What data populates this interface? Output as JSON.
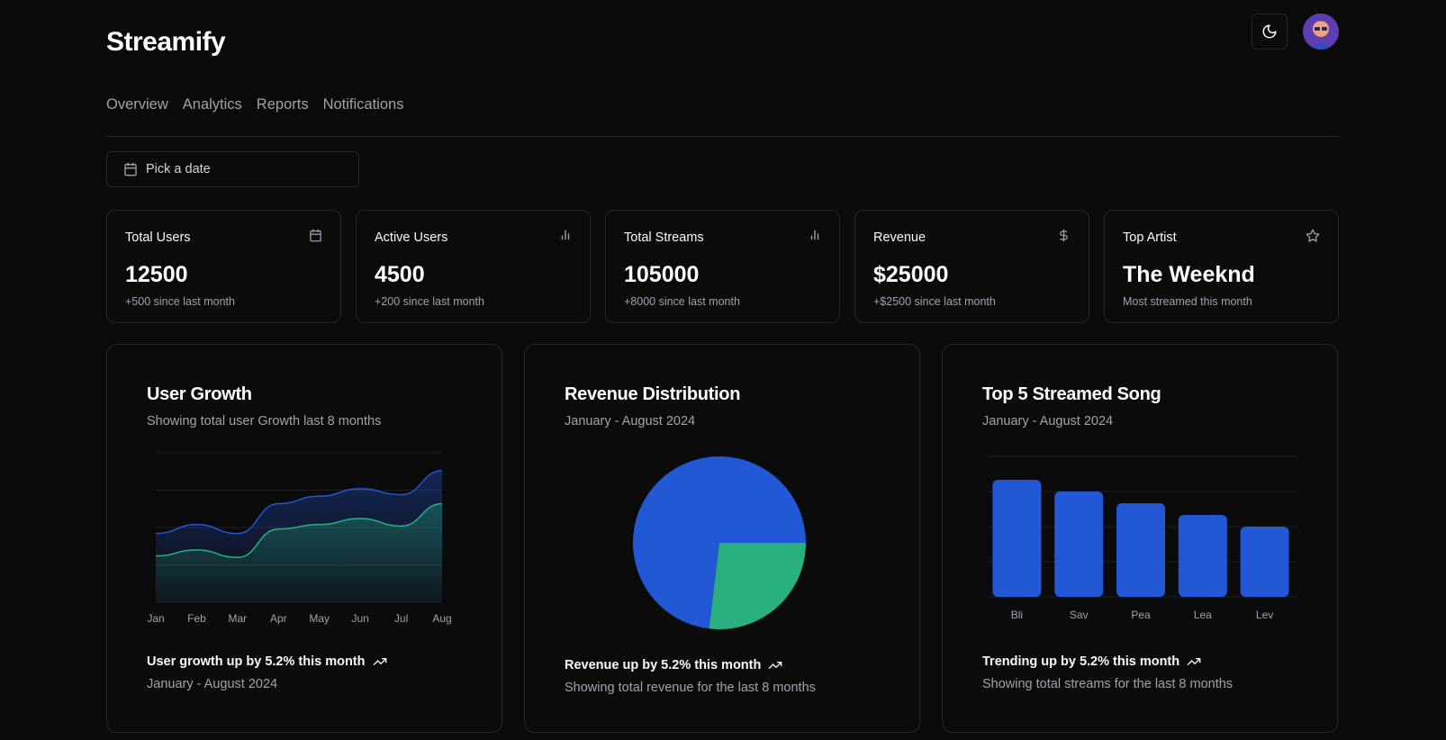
{
  "app": {
    "brand": "Streamify"
  },
  "header": {
    "theme_icon": "moon-icon",
    "avatar_icon": "user-avatar"
  },
  "tabs": [
    {
      "label": "Overview"
    },
    {
      "label": "Analytics"
    },
    {
      "label": "Reports"
    },
    {
      "label": "Notifications"
    }
  ],
  "date_picker": {
    "placeholder": "Pick a date",
    "icon": "calendar-icon"
  },
  "stats": [
    {
      "title": "Total Users",
      "value": "12500",
      "sub": "+500 since last month",
      "icon": "calendar-icon"
    },
    {
      "title": "Active Users",
      "value": "4500",
      "sub": "+200 since last month",
      "icon": "bar-chart-icon"
    },
    {
      "title": "Total Streams",
      "value": "105000",
      "sub": "+8000 since last month",
      "icon": "bar-chart-icon"
    },
    {
      "title": "Revenue",
      "value": "$25000",
      "sub": "+$2500 since last month",
      "icon": "dollar-icon"
    },
    {
      "title": "Top Artist",
      "value": "The Weeknd",
      "sub": "Most streamed this month",
      "icon": "star-icon"
    }
  ],
  "cards": {
    "growth": {
      "title": "User Growth",
      "desc": "Showing total user Growth last 8 months",
      "foot_main": "User growth up by 5.2% this month",
      "foot_sub": "January - August 2024"
    },
    "revenue": {
      "title": "Revenue Distribution",
      "desc": "January - August 2024",
      "foot_main": "Revenue up by 5.2% this month",
      "foot_sub": "Showing total revenue for the last 8 months"
    },
    "songs": {
      "title": "Top 5 Streamed Song",
      "desc": "January - August 2024",
      "foot_main": "Trending up by 5.2% this month",
      "foot_sub": "Showing total streams for the last 8 months"
    }
  },
  "colors": {
    "blue": "#2257d6",
    "green": "#2ab07f",
    "muted": "#a1a1aa",
    "border": "#27272a"
  },
  "chart_data": [
    {
      "type": "area",
      "categories": [
        "Jan",
        "Feb",
        "Mar",
        "Apr",
        "May",
        "Jun",
        "Jul",
        "Aug"
      ],
      "ylim": [
        0,
        100
      ],
      "grid": true,
      "series": [
        {
          "values": [
            46,
            52,
            46,
            66,
            71,
            76,
            72,
            88
          ],
          "color": "#2257d6"
        },
        {
          "values": [
            31,
            35,
            30,
            49,
            52,
            56,
            51,
            66
          ],
          "color": "#2ab07f"
        }
      ]
    },
    {
      "type": "pie",
      "values": [
        75,
        25
      ],
      "colors": [
        "#2257d6",
        "#2ab07f"
      ]
    },
    {
      "type": "bar",
      "categories": [
        "Bli",
        "Sav",
        "Pea",
        "Lea",
        "Lev"
      ],
      "values": [
        100,
        90,
        80,
        70,
        60
      ],
      "ylim": [
        0,
        120
      ],
      "grid": true,
      "color": "#2257d6"
    }
  ]
}
